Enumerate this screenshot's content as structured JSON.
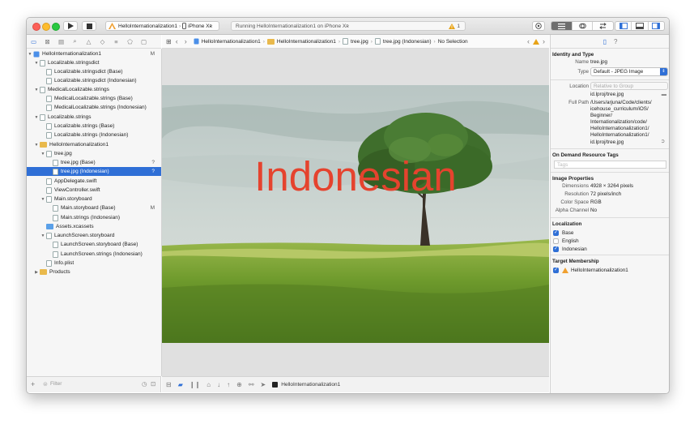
{
  "toolbar": {
    "scheme_target": "HelloInternationalization1",
    "scheme_device": "iPhone Xʀ",
    "activity_status": "Running HelloInternationalization1 on iPhone Xʀ",
    "warning_count": "1"
  },
  "navigator": {
    "items": [
      {
        "label": "HelloInternationalization1",
        "badge": "M"
      },
      {
        "label": "Localizable.stringsdict",
        "badge": ""
      },
      {
        "label": "Localizable.stringsdict (Base)",
        "badge": ""
      },
      {
        "label": "Localizable.stringsdict (Indonesian)",
        "badge": ""
      },
      {
        "label": "MedicalLocalizable.strings",
        "badge": ""
      },
      {
        "label": "MedicalLocalizable.strings (Base)",
        "badge": ""
      },
      {
        "label": "MedicalLocalizable.strings (Indonesian)",
        "badge": ""
      },
      {
        "label": "Localizable.strings",
        "badge": ""
      },
      {
        "label": "Localizable.strings (Base)",
        "badge": ""
      },
      {
        "label": "Localizable.strings (Indonesian)",
        "badge": ""
      },
      {
        "label": "HelloInternationalization1",
        "badge": ""
      },
      {
        "label": "tree.jpg",
        "badge": ""
      },
      {
        "label": "tree.jpg (Base)",
        "badge": "?"
      },
      {
        "label": "tree.jpg (Indonesian)",
        "badge": "?"
      },
      {
        "label": "AppDelegate.swift",
        "badge": ""
      },
      {
        "label": "ViewController.swift",
        "badge": ""
      },
      {
        "label": "Main.storyboard",
        "badge": ""
      },
      {
        "label": "Main.storyboard (Base)",
        "badge": "M"
      },
      {
        "label": "Main.strings (Indonesian)",
        "badge": ""
      },
      {
        "label": "Assets.xcassets",
        "badge": ""
      },
      {
        "label": "LaunchScreen.storyboard",
        "badge": ""
      },
      {
        "label": "LaunchScreen.storyboard (Base)",
        "badge": ""
      },
      {
        "label": "LaunchScreen.strings (Indonesian)",
        "badge": ""
      },
      {
        "label": "Info.plist",
        "badge": ""
      },
      {
        "label": "Products",
        "badge": ""
      }
    ],
    "filter_placeholder": "Filter"
  },
  "jumpbar": {
    "crumbs": [
      "HelloInternationalization1",
      "HelloInternationalization1",
      "tree.jpg",
      "tree.jpg (Indonesian)",
      "No Selection"
    ]
  },
  "editor": {
    "overlay_text": "Indonesian"
  },
  "debugbar": {
    "target": "HelloInternationalization1"
  },
  "inspector": {
    "identity_title": "Identity and Type",
    "name_label": "Name",
    "name_value": "tree.jpg",
    "type_label": "Type",
    "type_value": "Default - JPEG Image",
    "location_label": "Location",
    "location_value": "Relative to Group",
    "location_path": "id.lproj/tree.jpg",
    "fullpath_label": "Full Path",
    "fullpath_lines": [
      "/Users/arjuna/Code/clients/",
      "icehouse_curriculum/iOS/",
      "Beginner/",
      "Internationalization/code/",
      "HelloInternationalization1/",
      "HelloInternationalization1/",
      "id.lproj/tree.jpg"
    ],
    "odr_title": "On Demand Resource Tags",
    "tags_placeholder": "Tags",
    "image_props_title": "Image Properties",
    "dimensions_label": "Dimensions",
    "dimensions_value": "4928 × 3264 pixels",
    "resolution_label": "Resolution",
    "resolution_value": "72 pixels/inch",
    "colorspace_label": "Color Space",
    "colorspace_value": "RGB",
    "alpha_label": "Alpha Channel",
    "alpha_value": "No",
    "localization_title": "Localization",
    "localizations": [
      {
        "label": "Base",
        "checked": true
      },
      {
        "label": "English",
        "checked": false
      },
      {
        "label": "Indonesian",
        "checked": true
      }
    ],
    "target_membership_title": "Target Membership",
    "target_name": "HelloInternationalization1"
  },
  "colors": {
    "selection": "#2f6fd6",
    "overlay_text": "#e5432e",
    "warning": "#e8a317"
  }
}
